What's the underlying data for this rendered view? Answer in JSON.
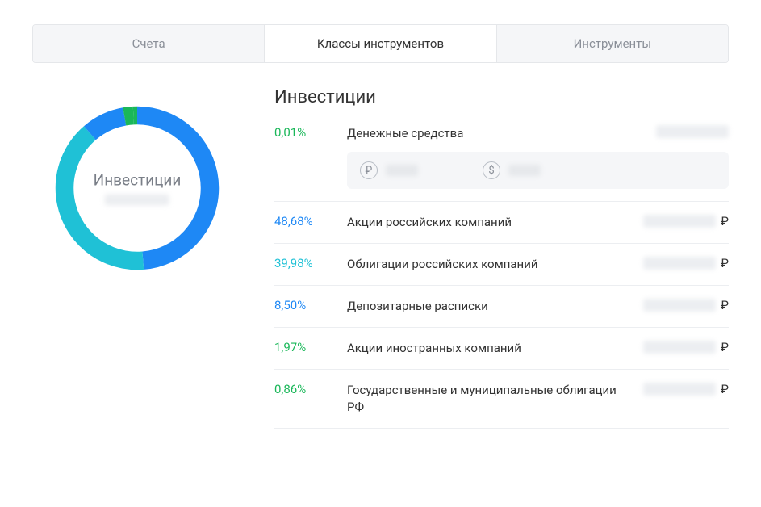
{
  "tabs": [
    {
      "label": "Счета",
      "active": false
    },
    {
      "label": "Классы инструментов",
      "active": true
    },
    {
      "label": "Инструменты",
      "active": false
    }
  ],
  "donut": {
    "title": "Инвестиции"
  },
  "list": {
    "title": "Инвестиции",
    "rows": [
      {
        "pct": "0,01%",
        "color": "green",
        "label": "Денежные средства",
        "currency": "",
        "cash_detail": true
      },
      {
        "pct": "48,68%",
        "color": "blue",
        "label": "Акции российских компаний",
        "currency": "₽"
      },
      {
        "pct": "39,98%",
        "color": "teal",
        "label": "Облигации российских компаний",
        "currency": "₽"
      },
      {
        "pct": "8,50%",
        "color": "blue",
        "label": "Депозитарные расписки",
        "currency": "₽"
      },
      {
        "pct": "1,97%",
        "color": "green",
        "label": "Акции иностранных компаний",
        "currency": "₽"
      },
      {
        "pct": "0,86%",
        "color": "green",
        "label": "Государственные и муниципальные облигации РФ",
        "currency": "₽"
      }
    ]
  },
  "cash_currencies": [
    {
      "symbol": "₽"
    },
    {
      "symbol": "$"
    }
  ],
  "chart_data": {
    "type": "pie",
    "title": "Инвестиции",
    "series": [
      {
        "name": "Акции российских компаний",
        "value": 48.68,
        "color": "#1e88f5"
      },
      {
        "name": "Облигации российских компаний",
        "value": 39.98,
        "color": "#1fc1d6"
      },
      {
        "name": "Депозитарные расписки",
        "value": 8.5,
        "color": "#1e88f5"
      },
      {
        "name": "Акции иностранных компаний",
        "value": 1.97,
        "color": "#1ab759"
      },
      {
        "name": "Государственные и муниципальные облигации РФ",
        "value": 0.86,
        "color": "#1ab759"
      },
      {
        "name": "Денежные средства",
        "value": 0.01,
        "color": "#1ab759"
      }
    ]
  }
}
